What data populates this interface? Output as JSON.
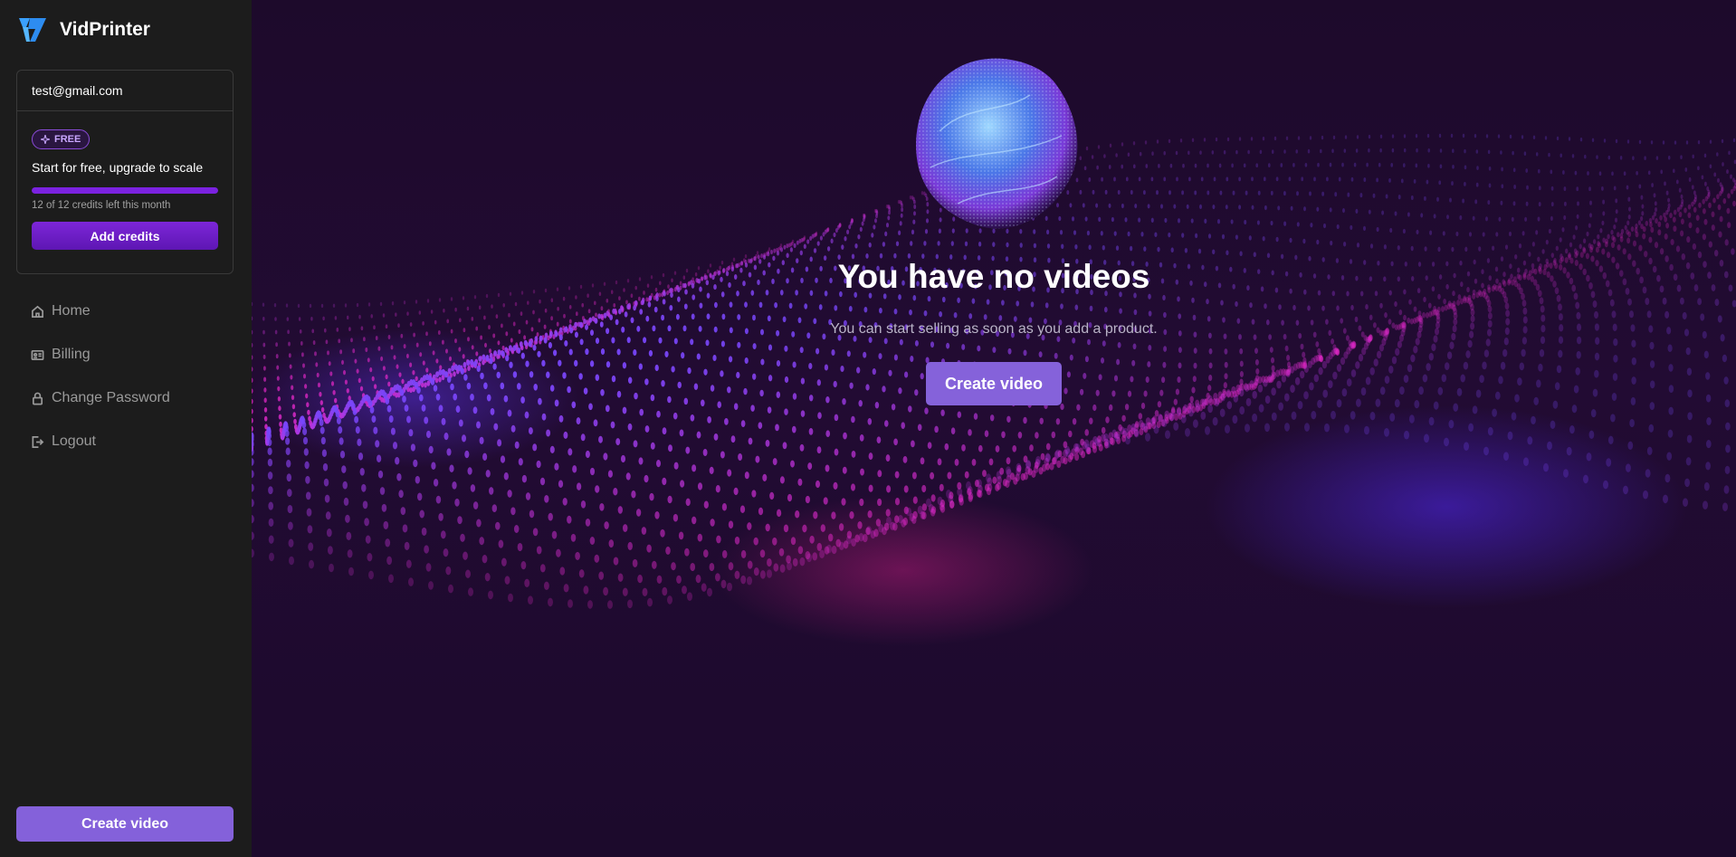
{
  "brand": {
    "name": "VidPrinter"
  },
  "account": {
    "email": "test@gmail.com",
    "plan_badge": "FREE",
    "plan_tagline": "Start for free, upgrade to scale",
    "credits_text": "12 of 12 credits left this month",
    "credits_fraction": 1.0,
    "add_credits_label": "Add credits"
  },
  "nav": {
    "items": [
      {
        "label": "Home",
        "icon": "home-icon"
      },
      {
        "label": "Billing",
        "icon": "id-card-icon"
      },
      {
        "label": "Change Password",
        "icon": "lock-icon"
      },
      {
        "label": "Logout",
        "icon": "logout-icon"
      }
    ]
  },
  "sidebar": {
    "create_label": "Create video"
  },
  "main": {
    "title": "You have no videos",
    "subtitle": "You can start selling as soon as you add a product.",
    "create_label": "Create video"
  },
  "colors": {
    "accent": "#8461da",
    "credits_bar": "#7b22e0",
    "sidebar_bg": "#1c1c1c",
    "main_bg": "#1d0a2b"
  }
}
